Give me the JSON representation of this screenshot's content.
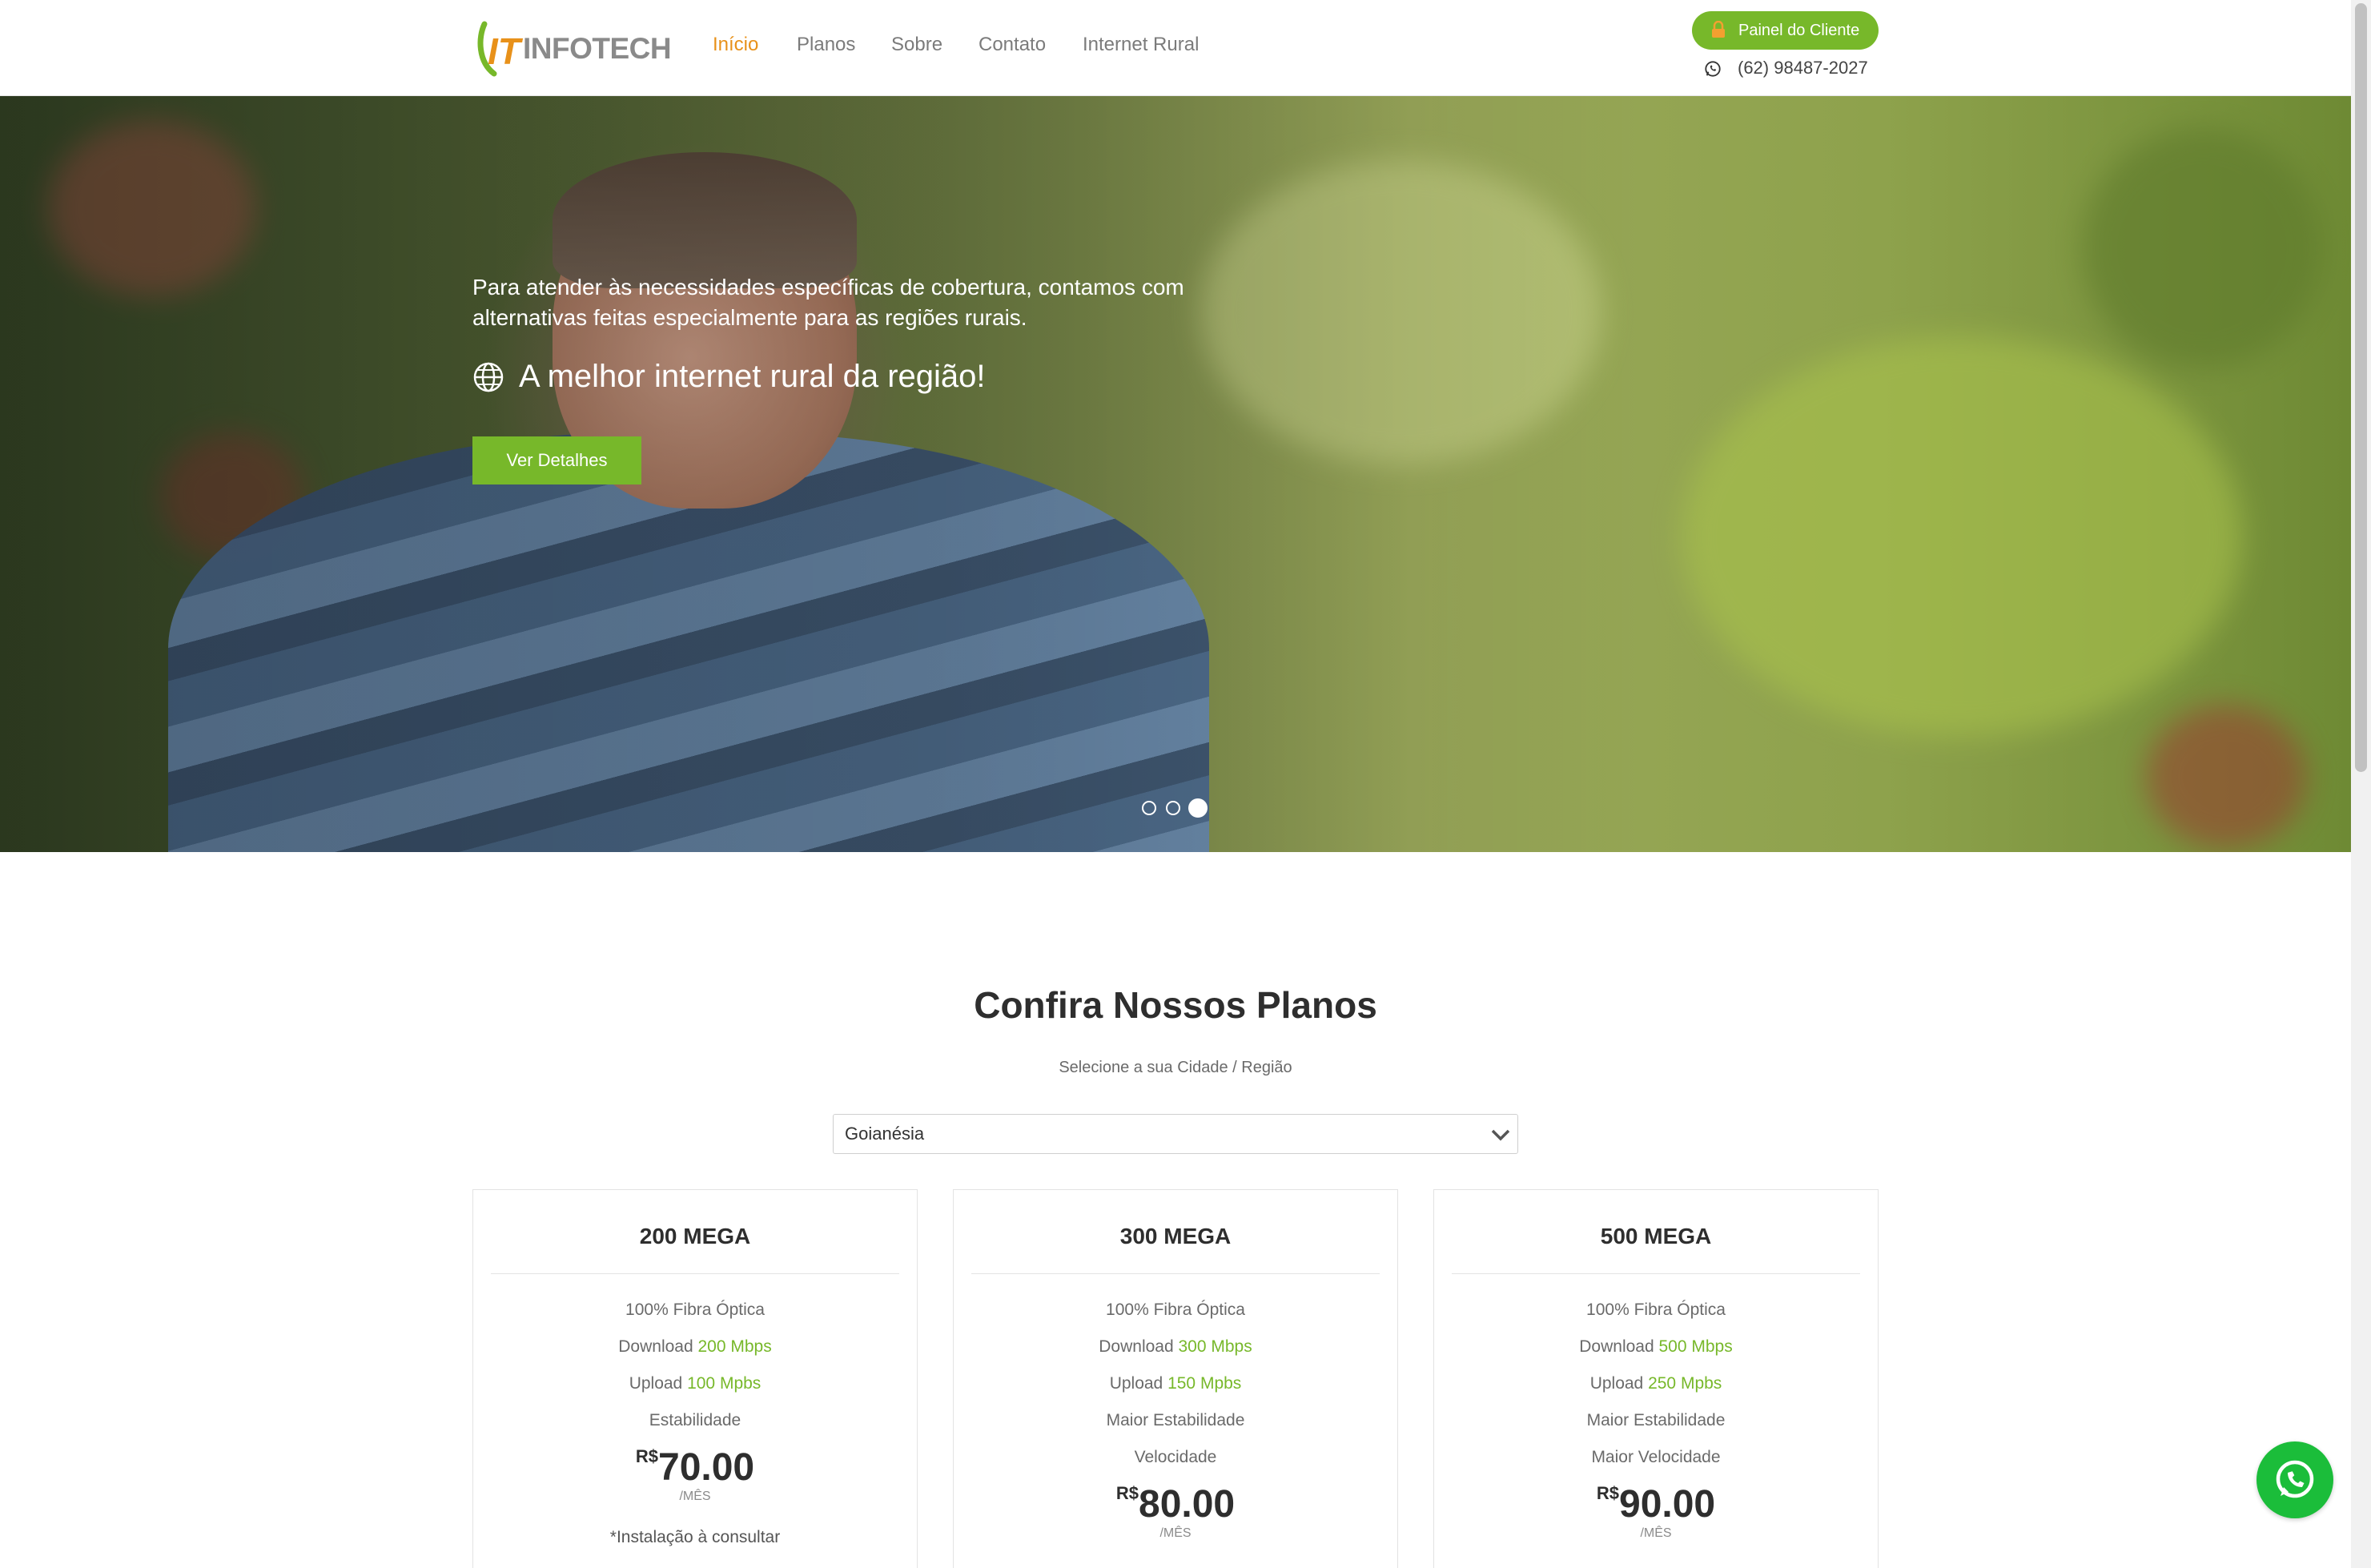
{
  "header": {
    "logo_text": "INFOTECH",
    "logo_mark": "IT",
    "nav": [
      {
        "label": "Início",
        "active": true
      },
      {
        "label": "Planos",
        "active": false
      },
      {
        "label": "Sobre",
        "active": false
      },
      {
        "label": "Contato",
        "active": false
      },
      {
        "label": "Internet Rural",
        "active": false
      }
    ],
    "panel_button": "Painel do Cliente",
    "phone": "(62) 98487-2027"
  },
  "hero": {
    "text": "Para atender às necessidades específicas de cobertura, contamos com alternativas feitas especialmente para as regiões rurais.",
    "headline": "A melhor internet rural da região!",
    "button": "Ver Detalhes",
    "slides": 3,
    "active_slide": 3
  },
  "plans": {
    "title": "Confira Nossos Planos",
    "subtitle": "Selecione a sua Cidade / Região",
    "region": "Goianésia",
    "cards": [
      {
        "name": "200 MEGA",
        "features": [
          {
            "text": "100% Fibra Óptica",
            "highlight": ""
          },
          {
            "text": "Download ",
            "highlight": "200 Mbps"
          },
          {
            "text": "Upload ",
            "highlight": "100 Mpbs"
          },
          {
            "text": "Estabilidade",
            "highlight": ""
          }
        ],
        "currency": "R$",
        "price": "70.00",
        "period": "/MÊS",
        "note": "*Instalação à consultar"
      },
      {
        "name": "300 MEGA",
        "features": [
          {
            "text": "100% Fibra Óptica",
            "highlight": ""
          },
          {
            "text": "Download ",
            "highlight": "300 Mbps"
          },
          {
            "text": "Upload ",
            "highlight": "150 Mpbs"
          },
          {
            "text": "Maior Estabilidade",
            "highlight": ""
          },
          {
            "text": "Velocidade",
            "highlight": ""
          }
        ],
        "currency": "R$",
        "price": "80.00",
        "period": "/MÊS",
        "note": ""
      },
      {
        "name": "500 MEGA",
        "features": [
          {
            "text": "100% Fibra Óptica",
            "highlight": ""
          },
          {
            "text": "Download ",
            "highlight": "500 Mbps"
          },
          {
            "text": "Upload ",
            "highlight": "250 Mpbs"
          },
          {
            "text": "Maior Estabilidade",
            "highlight": ""
          },
          {
            "text": "Maior Velocidade",
            "highlight": ""
          }
        ],
        "currency": "R$",
        "price": "90.00",
        "period": "/MÊS",
        "note": ""
      }
    ]
  },
  "colors": {
    "brand_green": "#77b82a",
    "nav_active": "#e8911a",
    "whatsapp": "#1bbd3a"
  },
  "icons": [
    "lock-icon",
    "whatsapp-icon",
    "globe-icon",
    "chevron-down-icon"
  ]
}
